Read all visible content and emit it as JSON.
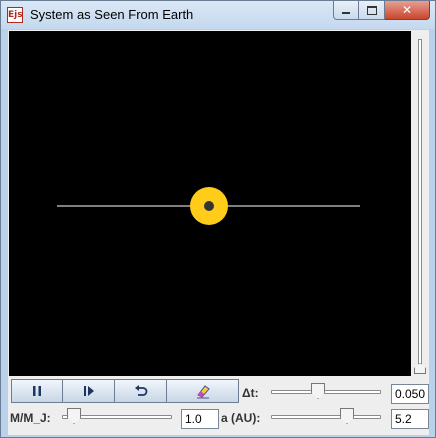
{
  "window": {
    "icon_label": "Ejs",
    "title": "System as Seen From Earth"
  },
  "view": {
    "star_color": "#ffcc1a",
    "background": "#000000",
    "line_color": "#ffffff"
  },
  "toolbar": {
    "buttons": [
      {
        "name": "pause",
        "glyph": "⏸"
      },
      {
        "name": "step",
        "glyph": "⏵"
      },
      {
        "name": "reset",
        "glyph": "↺"
      },
      {
        "name": "clear",
        "glyph": "✎"
      }
    ]
  },
  "controls": {
    "dt": {
      "label": "Δt:",
      "value": "0.050",
      "slider_fraction": 0.42
    },
    "mass": {
      "label": "M/M_J:",
      "value": "1.0",
      "slider_fraction": 0.05
    },
    "a": {
      "label": "a (AU):",
      "value": "5.2",
      "slider_fraction": 0.72
    }
  }
}
